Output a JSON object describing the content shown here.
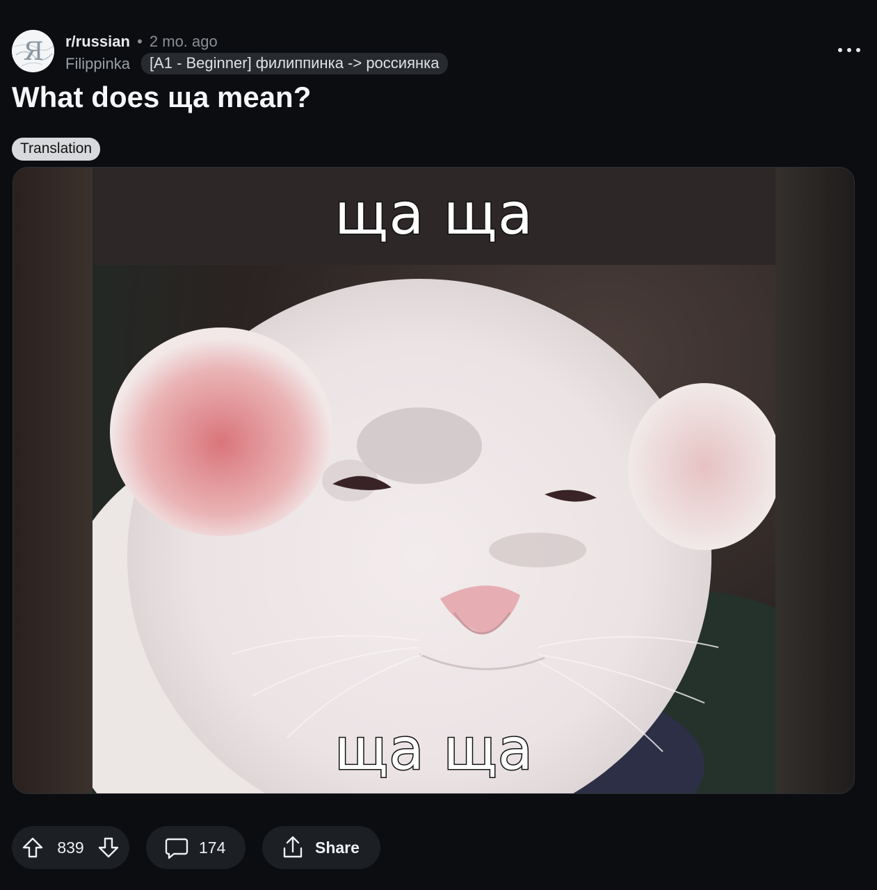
{
  "post": {
    "subreddit": "r/russian",
    "separator": "•",
    "time_ago": "2 mo. ago",
    "author": "Filippinka",
    "user_flair": "[A1 - Beginner] филиппинка -> россиянка",
    "title": "What does ща mean?",
    "post_flair": "Translation",
    "avatar_letter": "Я"
  },
  "media": {
    "caption_top": "ща ща",
    "caption_bottom": "ща ща"
  },
  "actions": {
    "upvotes": "839",
    "comments": "174",
    "share_label": "Share"
  },
  "icons": {
    "more": "more-dots-icon",
    "upvote": "upvote-arrow-icon",
    "downvote": "downvote-arrow-icon",
    "comment": "comment-bubble-icon",
    "share": "share-icon"
  },
  "colors": {
    "background": "#0b0d10",
    "pill": "#1c1f23",
    "user_flair_bg": "#272a2f",
    "post_flair_bg": "#d7d9dc"
  }
}
